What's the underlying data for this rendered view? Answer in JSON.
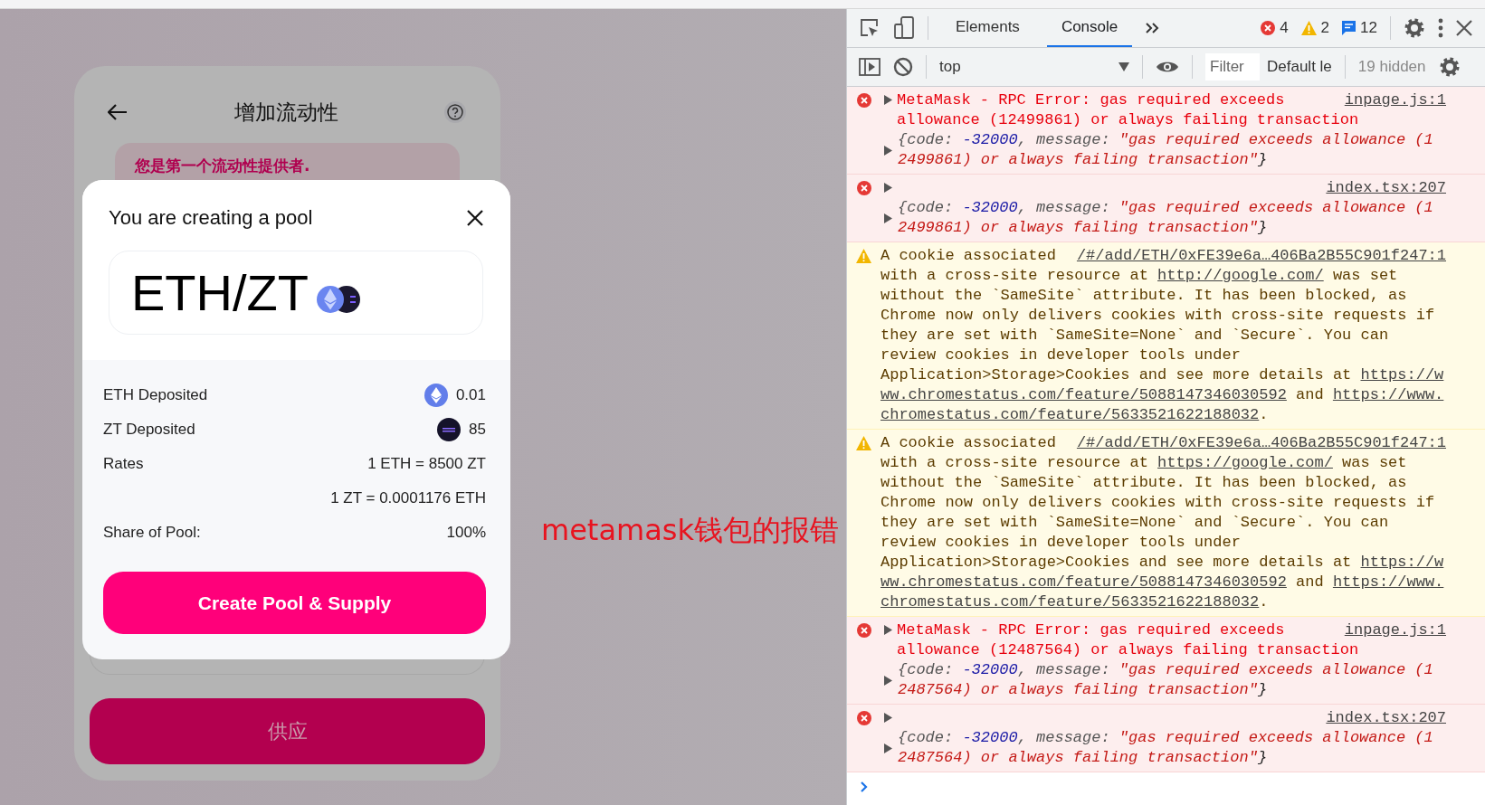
{
  "app": {
    "title": "增加流动性",
    "banner": "您是第一个流动性提供者.",
    "supply_button": "供应"
  },
  "modal": {
    "title": "You are creating a pool",
    "pair": "ETH/ZT",
    "rows": [
      {
        "kind": "eth",
        "label": "ETH Deposited",
        "values": [
          "0.01"
        ]
      },
      {
        "kind": "zt",
        "label": "ZT Deposited",
        "values": [
          "85"
        ]
      },
      {
        "kind": "plain",
        "label": "Rates",
        "values": [
          "1 ETH = 8500 ZT",
          "1 ZT = 0.0001176 ETH"
        ]
      },
      {
        "kind": "plain",
        "label": "Share of Pool:",
        "values": [
          "100%"
        ]
      }
    ],
    "button": "Create Pool & Supply"
  },
  "annotation": "metamask钱包的报错",
  "devtools": {
    "tabs": [
      {
        "label": "Elements",
        "selected": false
      },
      {
        "label": "Console",
        "selected": true
      }
    ],
    "counts": {
      "errors": "4",
      "warnings": "2",
      "messages": "12"
    },
    "context": "top",
    "filter_placeholder": "Filter",
    "levels": "Default le",
    "hidden": "19 hidden",
    "messages": [
      {
        "kind": "error",
        "source": "inpage.js:1",
        "expandable": true,
        "parts": [
          {
            "text": "MetaMask - RPC Error: gas required exceeds ",
            "kind": "plain"
          },
          {
            "text": "allowance (12499861) or always failing transaction",
            "kind": "plain"
          }
        ],
        "object": [
          {
            "text": "{code: ",
            "kind": "key"
          },
          {
            "text": "-32000",
            "kind": "number"
          },
          {
            "text": ", message: ",
            "kind": "key"
          },
          {
            "text": "\"gas required exceeds allowance (12499861) or always failing transaction\"",
            "kind": "string"
          },
          {
            "text": "}",
            "kind": "punct"
          }
        ]
      },
      {
        "kind": "error",
        "source": "index.tsx:207",
        "expandable": true,
        "object": [
          {
            "text": "{code: ",
            "kind": "key"
          },
          {
            "text": "-32000",
            "kind": "number"
          },
          {
            "text": ", message: ",
            "kind": "key"
          },
          {
            "text": "\"gas required exceeds allowance (12499861) or always failing transaction\"",
            "kind": "string"
          },
          {
            "text": "}",
            "kind": "punct"
          }
        ]
      },
      {
        "kind": "warning",
        "source": "/#/add/ETH/0xFE39e6a…406Ba2B55C901f247:1",
        "expandable": false,
        "parts": [
          {
            "text": "A cookie associated ",
            "kind": "plain"
          },
          {
            "text": "with a cross-site resource at ",
            "kind": "plain"
          },
          {
            "text": "http://google.com/",
            "kind": "link"
          },
          {
            "text": " was set without the `SameSite` attribute. It has been blocked, as Chrome now only delivers cookies with cross-site requests if they are set with `SameSite=None` and `Secure`. You can review cookies in developer tools under Application>Storage>Cookies and see more details at ",
            "kind": "plain"
          },
          {
            "text": "https://w",
            "kind": "link"
          },
          {
            "text": "ww.chromestatus.com/feature/5088147346030592",
            "kind": "link"
          },
          {
            "text": " and ",
            "kind": "plain"
          },
          {
            "text": "https://www.",
            "kind": "link"
          },
          {
            "text": "chromestatus.com/feature/5633521622188032",
            "kind": "link"
          },
          {
            "text": ".",
            "kind": "plain"
          }
        ]
      },
      {
        "kind": "warning",
        "source": "/#/add/ETH/0xFE39e6a…406Ba2B55C901f247:1",
        "expandable": false,
        "parts": [
          {
            "text": "A cookie associated ",
            "kind": "plain"
          },
          {
            "text": "with a cross-site resource at ",
            "kind": "plain"
          },
          {
            "text": "https://google.com/",
            "kind": "link"
          },
          {
            "text": " was set without the `SameSite` attribute. It has been blocked, as Chrome now only delivers cookies with cross-site requests if they are set with `SameSite=None` and `Secure`. You can review cookies in developer tools under Application>Storage>Cookies and see more details at ",
            "kind": "plain"
          },
          {
            "text": "https://w",
            "kind": "link"
          },
          {
            "text": "ww.chromestatus.com/feature/5088147346030592",
            "kind": "link"
          },
          {
            "text": " and ",
            "kind": "plain"
          },
          {
            "text": "https://www.",
            "kind": "link"
          },
          {
            "text": "chromestatus.com/feature/5633521622188032",
            "kind": "link"
          },
          {
            "text": ".",
            "kind": "plain"
          }
        ]
      },
      {
        "kind": "error",
        "source": "inpage.js:1",
        "expandable": true,
        "parts": [
          {
            "text": "MetaMask - RPC Error: gas required exceeds ",
            "kind": "plain"
          },
          {
            "text": "allowance (12487564) or always failing transaction",
            "kind": "plain"
          }
        ],
        "object": [
          {
            "text": "{code: ",
            "kind": "key"
          },
          {
            "text": "-32000",
            "kind": "number"
          },
          {
            "text": ", message: ",
            "kind": "key"
          },
          {
            "text": "\"gas required exceeds allowance (12487564) or always failing transaction\"",
            "kind": "string"
          },
          {
            "text": "}",
            "kind": "punct"
          }
        ]
      },
      {
        "kind": "error",
        "source": "index.tsx:207",
        "expandable": true,
        "object": [
          {
            "text": "{code: ",
            "kind": "key"
          },
          {
            "text": "-32000",
            "kind": "number"
          },
          {
            "text": ", message: ",
            "kind": "key"
          },
          {
            "text": "\"gas required exceeds allowance (12487564) or always failing transaction\"",
            "kind": "string"
          },
          {
            "text": "}",
            "kind": "punct"
          }
        ]
      }
    ]
  }
}
